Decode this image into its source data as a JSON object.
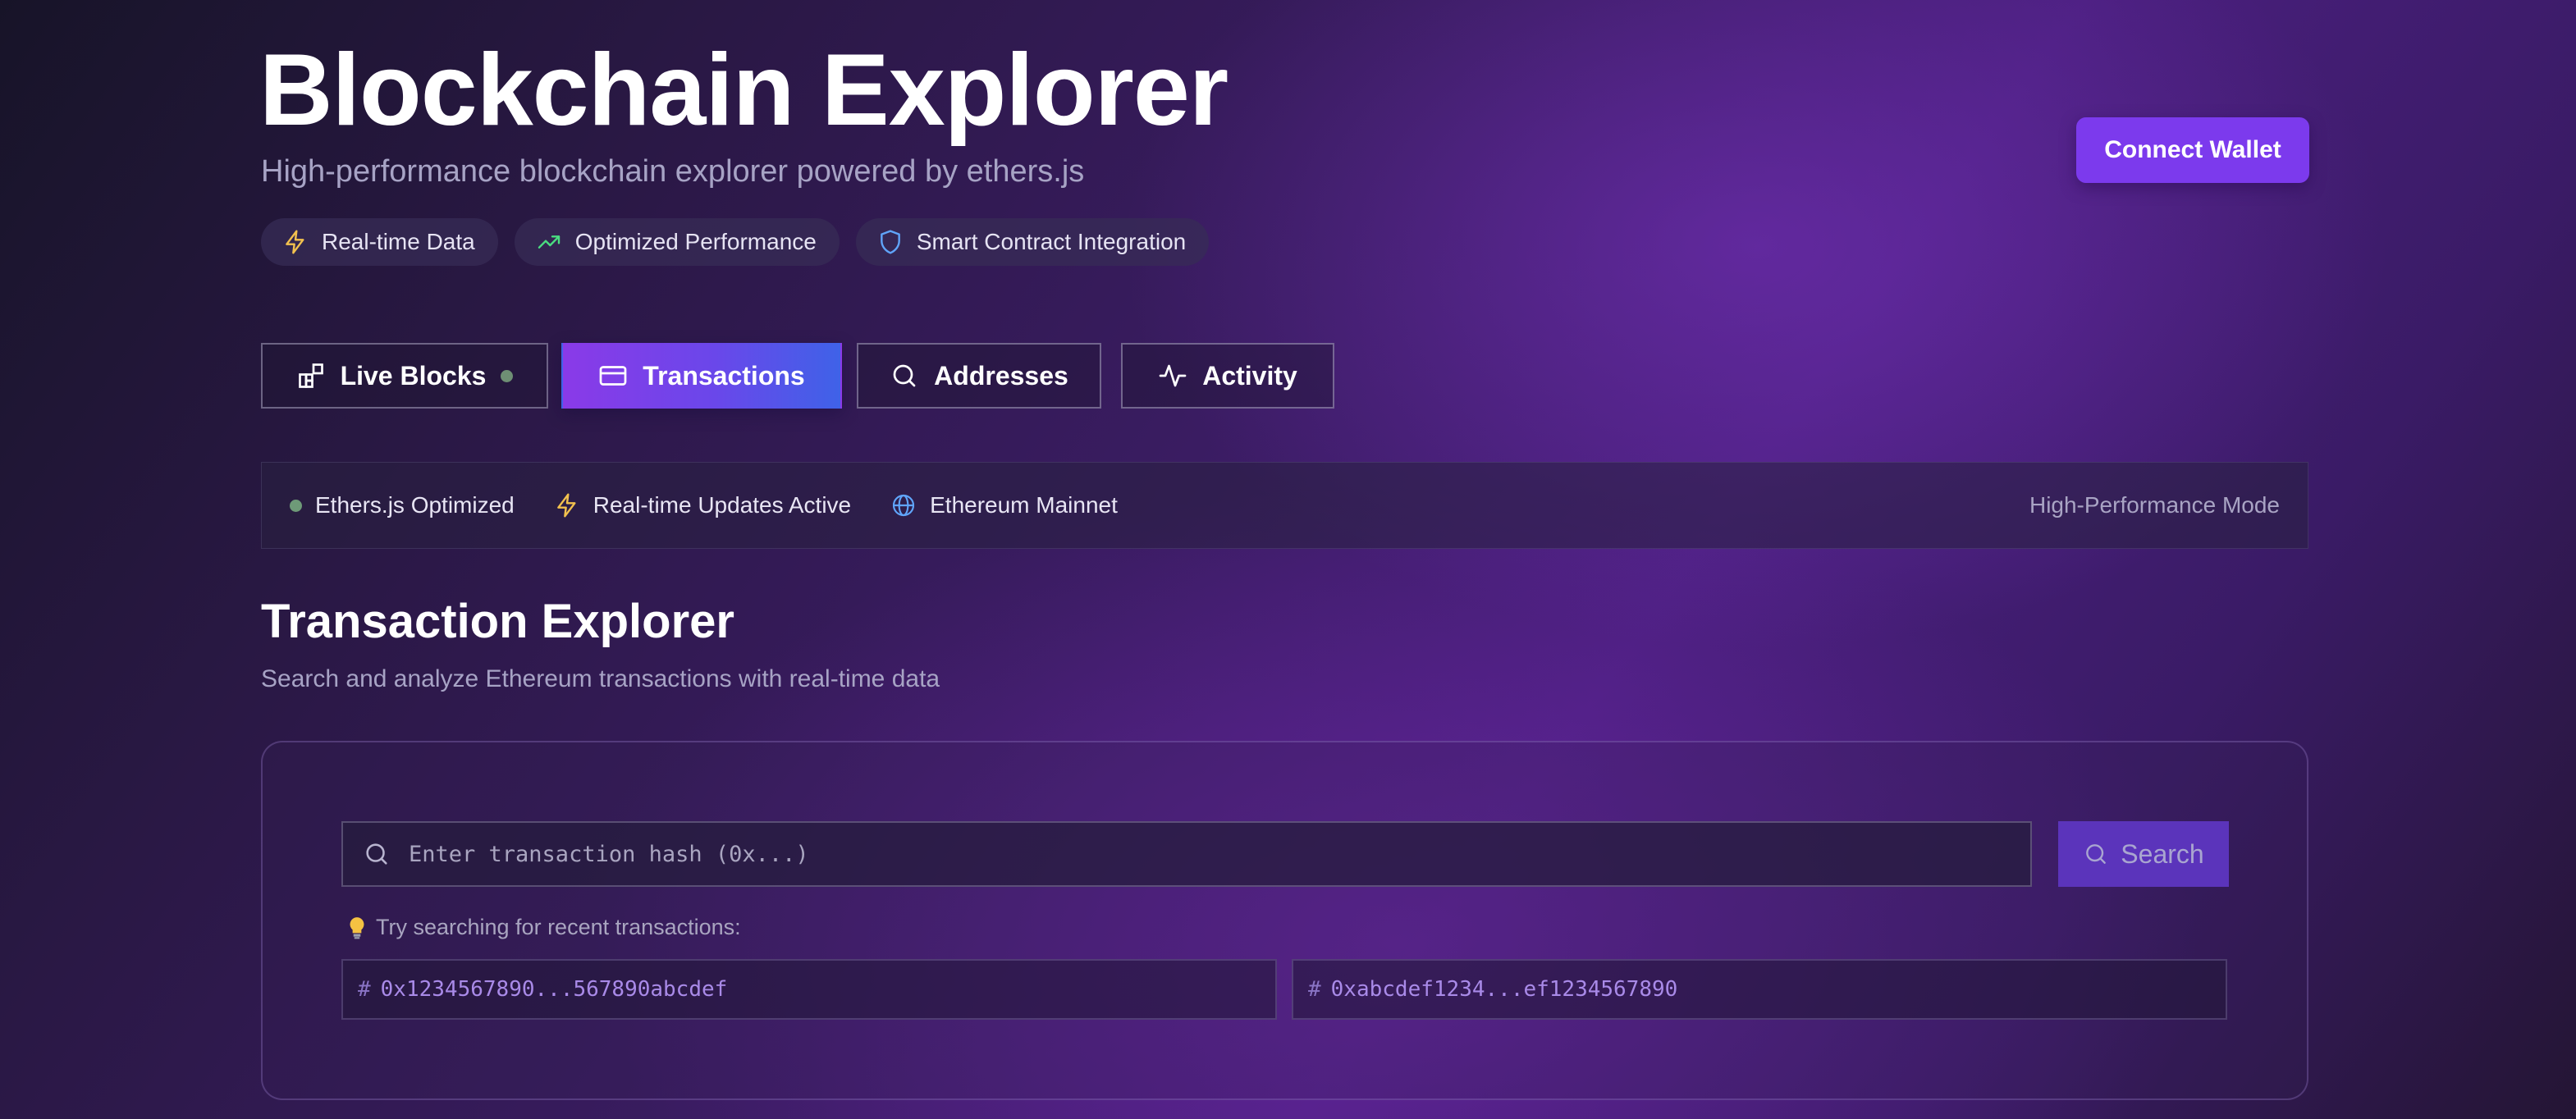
{
  "header": {
    "title": "Blockchain Explorer",
    "subtitle": "High-performance blockchain explorer powered by ethers.js",
    "pills": [
      {
        "label": "Real-time Data",
        "icon": "lightning-icon",
        "color": "#f2c14e"
      },
      {
        "label": "Optimized Performance",
        "icon": "trending-up-icon",
        "color": "#4ade80"
      },
      {
        "label": "Smart Contract Integration",
        "icon": "shield-icon",
        "color": "#60a5fa"
      }
    ],
    "connect_wallet_label": "Connect Wallet"
  },
  "tabs": [
    {
      "label": "Live Blocks",
      "icon": "blocks-icon",
      "live_indicator": true
    },
    {
      "label": "Transactions",
      "icon": "card-icon",
      "active": true
    },
    {
      "label": "Addresses",
      "icon": "search-icon"
    },
    {
      "label": "Activity",
      "icon": "activity-icon"
    }
  ],
  "status_bar": {
    "items": [
      {
        "label": "Ethers.js Optimized",
        "icon": "green-dot"
      },
      {
        "label": "Real-time Updates Active",
        "icon": "lightning-icon"
      },
      {
        "label": "Ethereum Mainnet",
        "icon": "globe-icon"
      }
    ],
    "mode": "High-Performance Mode"
  },
  "section": {
    "title": "Transaction Explorer",
    "subtitle": "Search and analyze Ethereum transactions with real-time data"
  },
  "search": {
    "placeholder": "Enter transaction hash (0x...)",
    "button_label": "Search",
    "hint": "Try searching for recent transactions:",
    "suggestions": [
      "0x1234567890...567890abcdef",
      "0xabcdef1234...ef1234567890"
    ]
  },
  "colors": {
    "accent": "#7c3aed",
    "tab_gradient_start": "#8a3ae8",
    "tab_gradient_end": "#3f62e8"
  }
}
